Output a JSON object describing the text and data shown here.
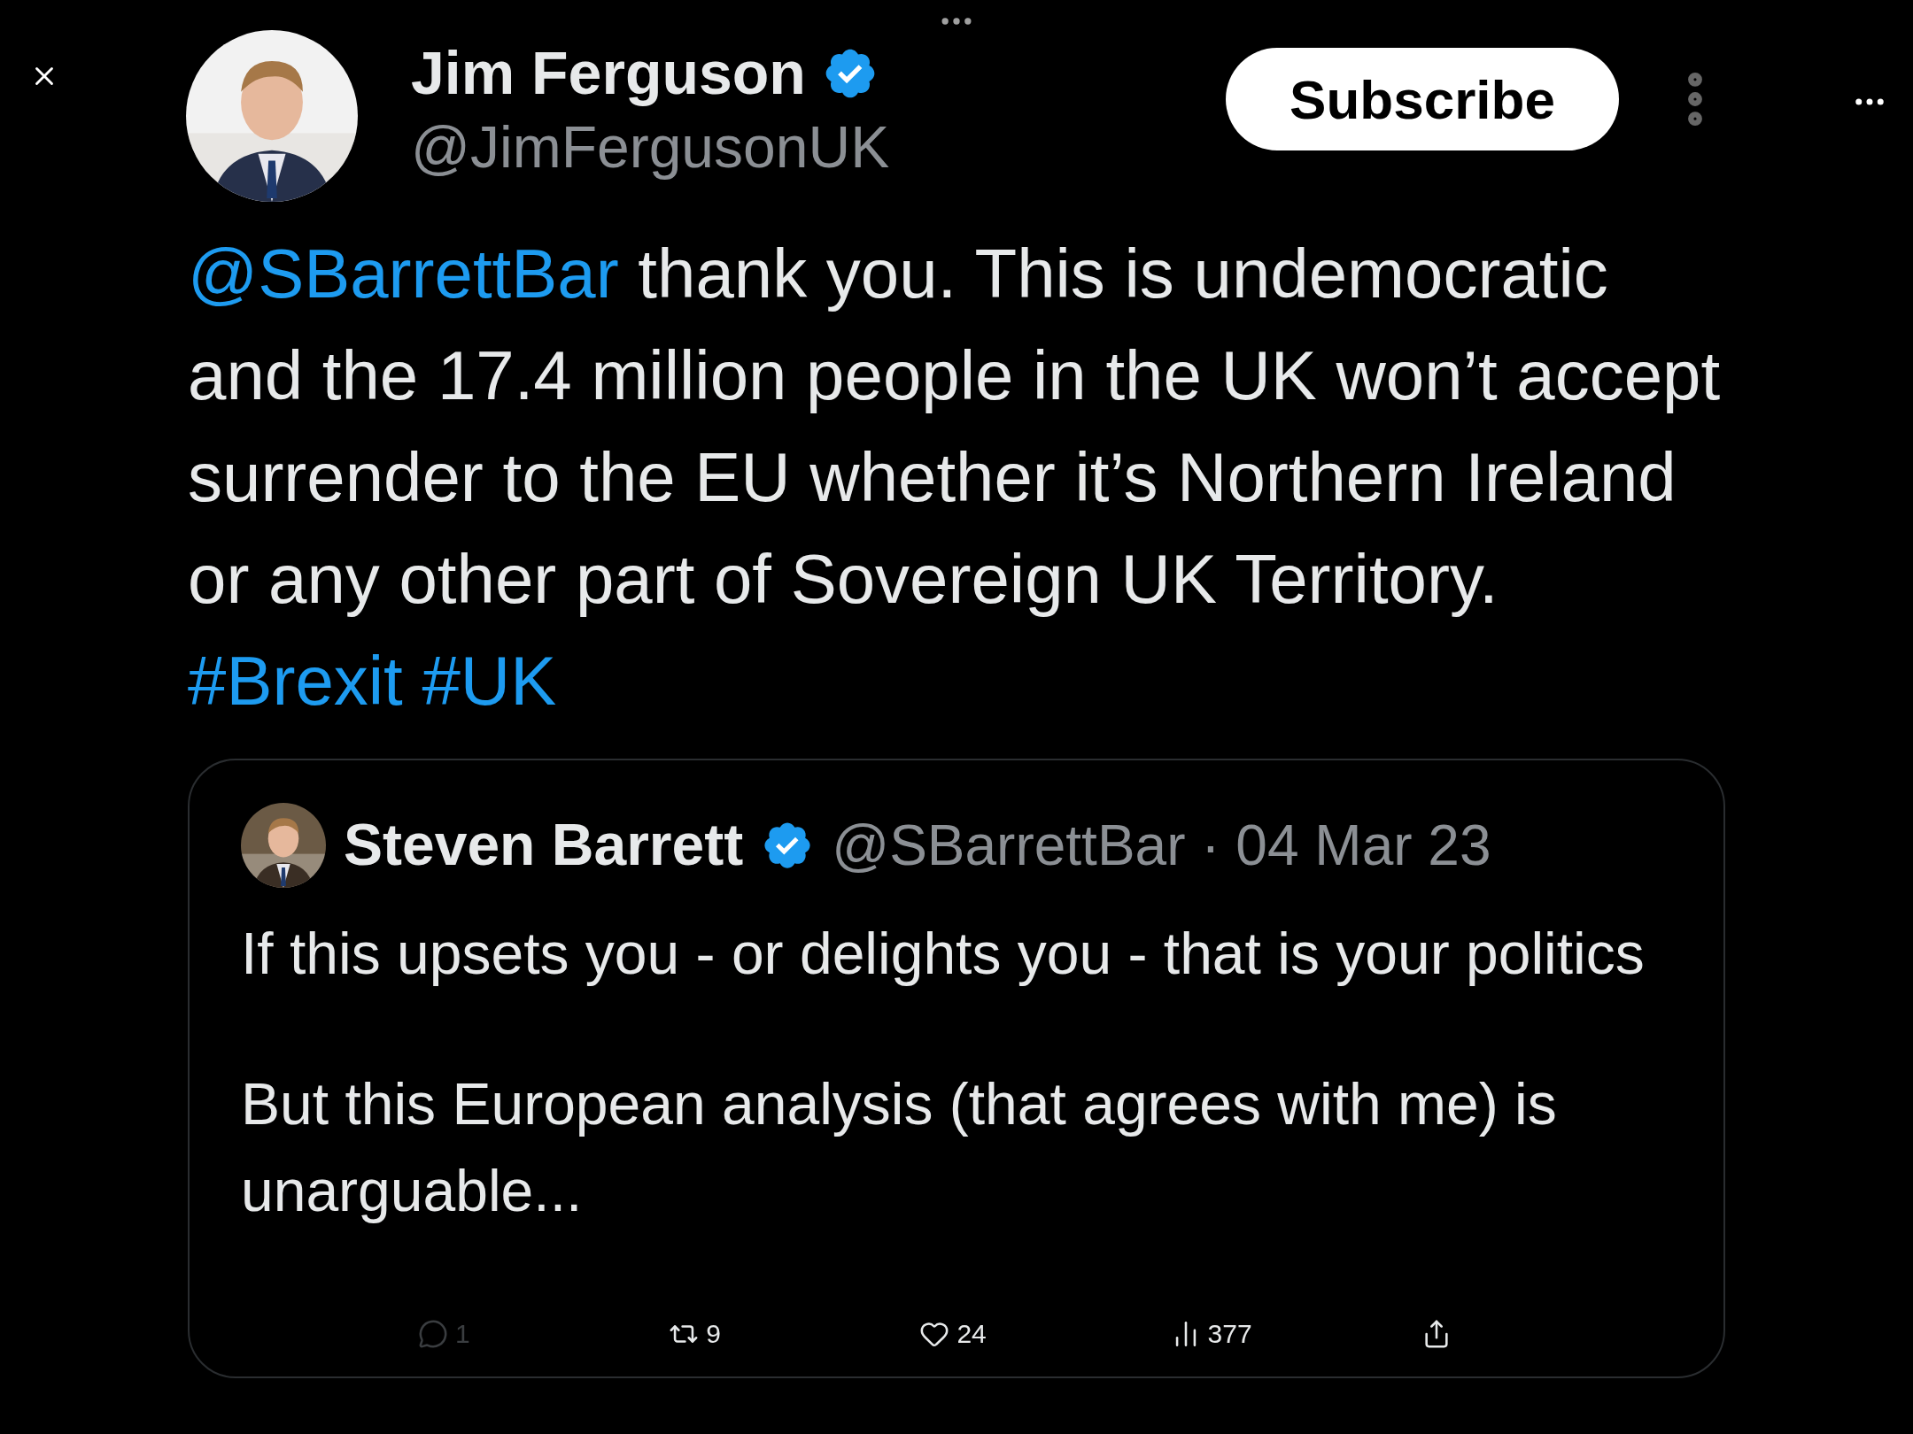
{
  "author": {
    "name": "Jim Ferguson",
    "handle": "@JimFergusonUK",
    "verified": true
  },
  "subscribe_button": "Subscribe",
  "tweet": {
    "mention": "@SBarrettBar",
    "text": "thank you. This is undemocratic and the 17.4 million people in the UK won’t accept surrender to the EU whether it’s Northern Ireland or any other part of Sovereign UK Territory.",
    "hashtags": [
      "#Brexit",
      "#UK"
    ]
  },
  "quoted": {
    "name": "Steven Barrett",
    "verified": true,
    "handle": "@SBarrettBar",
    "separator": "·",
    "date": "04 Mar 23",
    "paragraphs": [
      "If this upsets you - or delights you - that is your politics",
      "But this European analysis (that agrees with me) is unarguable..."
    ]
  },
  "actions": [
    {
      "kind": "reply",
      "count": "1",
      "disabled": true
    },
    {
      "kind": "retweet",
      "count": "9",
      "disabled": false
    },
    {
      "kind": "like",
      "count": "24",
      "disabled": false
    },
    {
      "kind": "views",
      "count": "377",
      "disabled": false
    },
    {
      "kind": "share",
      "disabled": false
    }
  ]
}
